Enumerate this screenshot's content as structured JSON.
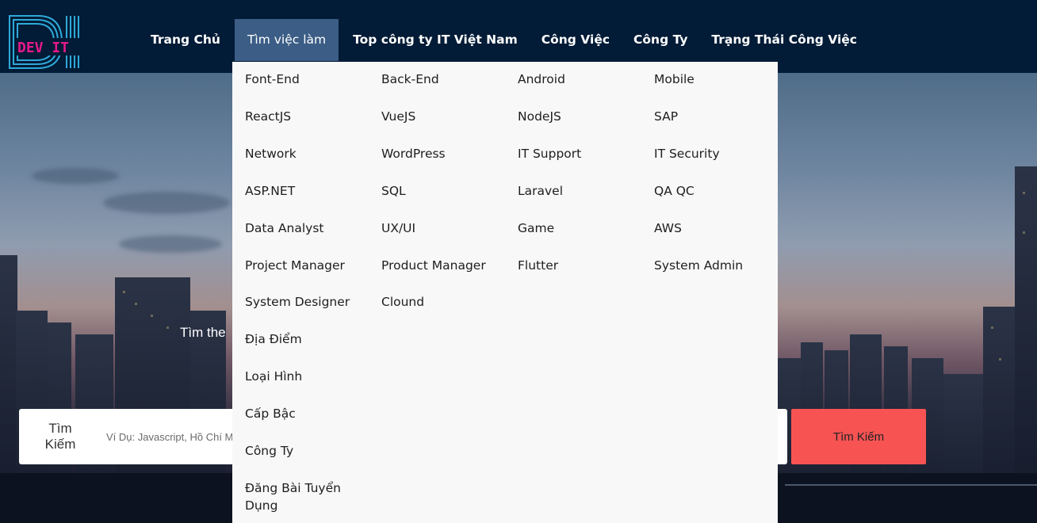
{
  "logo": {
    "letters_top": "D",
    "letters_bottom": "DEV IT"
  },
  "nav": {
    "items": [
      "Trang Chủ",
      "Tìm việc làm",
      "Top công ty IT Việt Nam",
      "Công Việc",
      "Công Ty",
      "Trạng Thái Công Việc"
    ],
    "active_index": 1
  },
  "dropdown": {
    "columns": [
      [
        "Font-End",
        "ReactJS",
        "Network",
        "ASP.NET",
        "Data Analyst",
        "Project Manager",
        "System Designer",
        "Địa Điểm",
        "Loại Hình",
        "Cấp Bậc",
        "Công Ty",
        "Đăng Bài Tuyển Dụng"
      ],
      [
        "Back-End",
        "VueJS",
        "WordPress",
        "SQL",
        "UX/UI",
        "Product Manager",
        "Clound"
      ],
      [
        "Android",
        "NodeJS",
        "IT Support",
        "Laravel",
        "Game",
        "Flutter"
      ],
      [
        "Mobile",
        "SAP",
        "IT Security",
        "QA QC",
        "AWS",
        "System Admin"
      ]
    ]
  },
  "hero": {
    "text": "Tìm the"
  },
  "search": {
    "label": "Tìm Kiếm",
    "placeholder": "Ví Dụ: Javascript, Hồ Chí Minh",
    "button": "Tìm Kiếm"
  },
  "colors": {
    "header_bg": "#021b36",
    "nav_active_bg": "#3b5d86",
    "dropdown_bg": "#f8f8f8",
    "search_button_bg": "#f75353",
    "logo_pink": "#e8198b",
    "logo_blue": "#2fa9d8"
  }
}
